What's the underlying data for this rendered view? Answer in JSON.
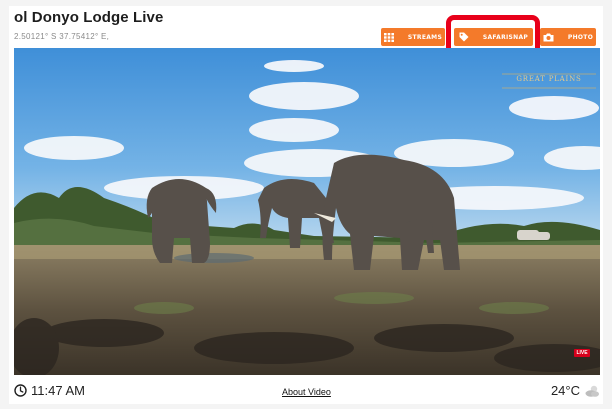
{
  "header": {
    "title": "ol Donyo Lodge Live",
    "coordinates": "2.50121° S   37.75412° E,"
  },
  "toolbar": {
    "streams_label": "STREAMS",
    "streams_icon": "grid-icon",
    "safarisnap_label": "SAFARISNAP",
    "safarisnap_icon": "tag-icon",
    "photo_label": "PHOTO",
    "photo_icon": "camera-icon",
    "accent_color": "#f47a2a",
    "highlight_color": "#e8001a"
  },
  "video": {
    "watermark": "GREAT PLAINS",
    "live_badge": "LIVE"
  },
  "footer": {
    "time": "11:47 AM",
    "about_label": "About Video",
    "temperature": "24°C",
    "weather_icon": "partly-cloudy-icon"
  }
}
